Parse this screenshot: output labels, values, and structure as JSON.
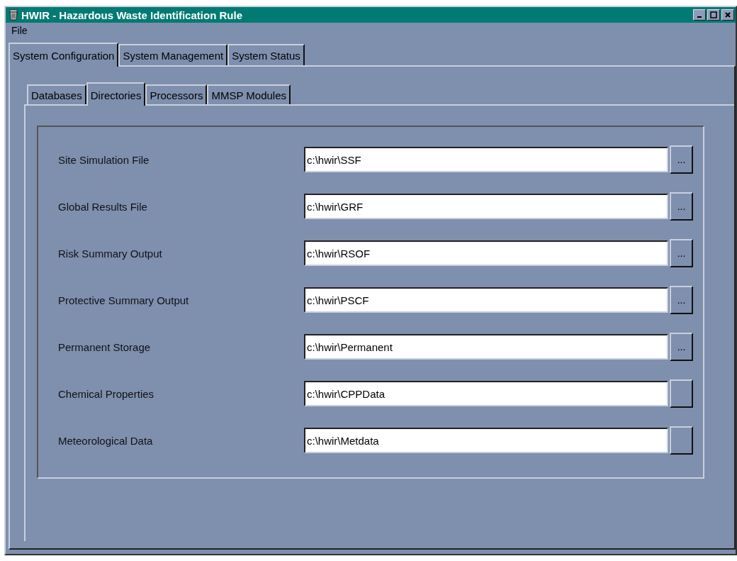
{
  "window": {
    "title": "HWIR - Hazardous Waste Identification Rule"
  },
  "menu": [
    "File"
  ],
  "tabs": [
    {
      "label": "System Configuration",
      "selected": true
    },
    {
      "label": "System Management",
      "selected": false
    },
    {
      "label": "System Status",
      "selected": false
    }
  ],
  "subtabs": [
    {
      "label": "Databases",
      "selected": false
    },
    {
      "label": "Directories",
      "selected": true
    },
    {
      "label": "Processors",
      "selected": false
    },
    {
      "label": "MMSP Modules",
      "selected": false
    }
  ],
  "rows": [
    {
      "label": "Site Simulation File",
      "value": "c:\\hwir\\SSF",
      "button": "..."
    },
    {
      "label": "Global Results File",
      "value": "c:\\hwir\\GRF",
      "button": "..."
    },
    {
      "label": "Risk Summary Output",
      "value": "c:\\hwir\\RSOF",
      "button": "..."
    },
    {
      "label": "Protective Summary Output",
      "value": "c:\\hwir\\PSCF",
      "button": "..."
    },
    {
      "label": "Permanent Storage",
      "value": "c:\\hwir\\Permanent",
      "button": "..."
    },
    {
      "label": "Chemical Properties",
      "value": "c:\\hwir\\CPPData"
    },
    {
      "label": "Meteorological Data",
      "value": "c:\\hwir\\Metdata"
    }
  ]
}
